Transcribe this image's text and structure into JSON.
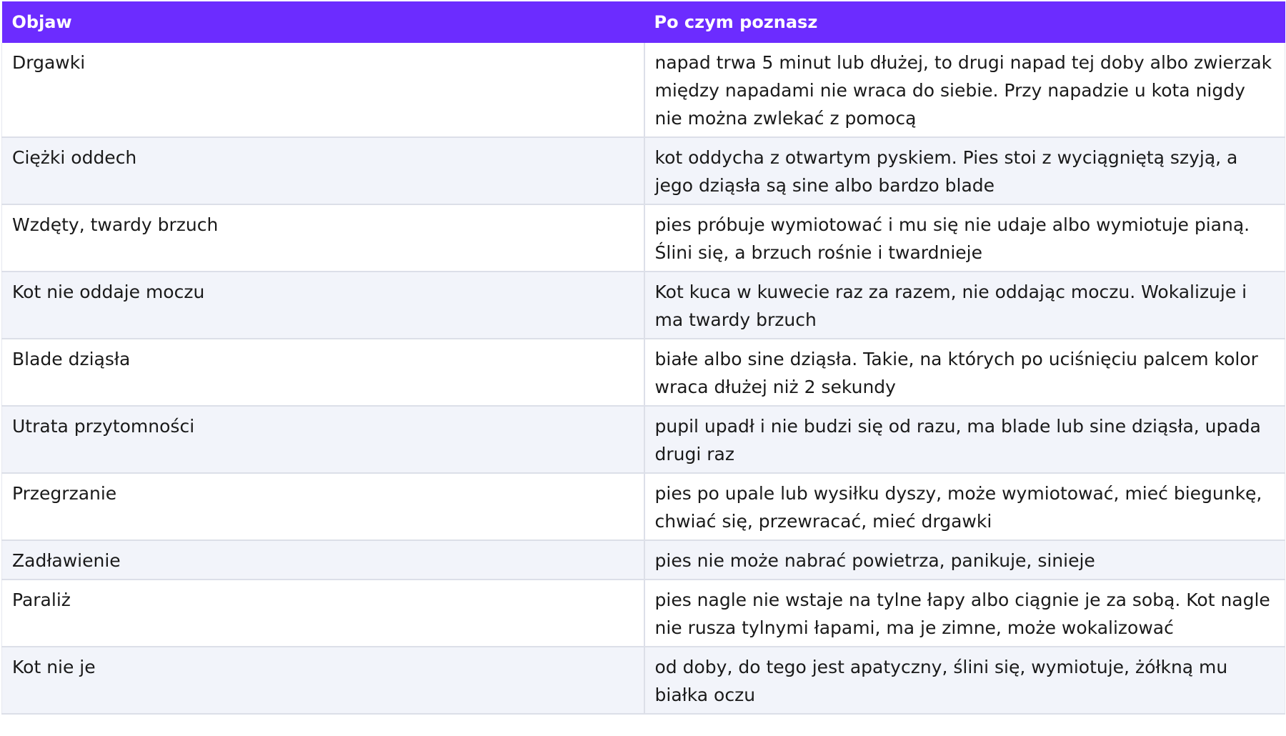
{
  "table": {
    "headers": [
      "Objaw",
      "Po czym poznasz"
    ],
    "rows": [
      [
        "Drgawki",
        "napad trwa 5 minut lub dłużej, to drugi napad tej doby albo zwierzak między napadami nie wraca do siebie. Przy napadzie u kota nigdy nie można zwlekać z pomocą"
      ],
      [
        "Ciężki oddech",
        "kot oddycha z otwartym pyskiem. Pies stoi z wyciągniętą szyją, a jego dziąsła są sine albo bardzo blade"
      ],
      [
        "Wzdęty, twardy brzuch",
        "pies próbuje wymiotować i mu się nie udaje albo wymiotuje pianą. Ślini się, a brzuch rośnie i twardnieje"
      ],
      [
        "Kot nie oddaje moczu",
        "Kot kuca w kuwecie raz za razem, nie oddając moczu. Wokalizuje i ma twardy brzuch"
      ],
      [
        "Blade dziąsła",
        "białe albo sine dziąsła. Takie, na których po uciśnięciu palcem kolor wraca dłużej niż 2 sekundy"
      ],
      [
        "Utrata przytomności",
        "pupil upadł i nie budzi się od razu, ma blade lub sine dziąsła, upada drugi raz"
      ],
      [
        "Przegrzanie",
        "pies po upale lub wysiłku dyszy, może wymiotować, mieć biegunkę, chwiać się, przewracać, mieć drgawki"
      ],
      [
        "Zadławienie",
        "pies nie może nabrać powietrza, panikuje, sinieje"
      ],
      [
        "Paraliż",
        "pies nagle nie wstaje na tylne łapy albo ciągnie je za sobą. Kot nagle nie rusza tylnymi łapami, ma je zimne, może wokalizować"
      ],
      [
        "Kot nie je",
        "od doby, do tego jest apatyczny, ślini się, wymiotuje, żółkną mu białka oczu"
      ]
    ]
  },
  "colors": {
    "header_bg": "#6c2cff",
    "header_text": "#ffffff",
    "stripe_bg": "#f2f4fa",
    "border": "#dcdfe8"
  }
}
